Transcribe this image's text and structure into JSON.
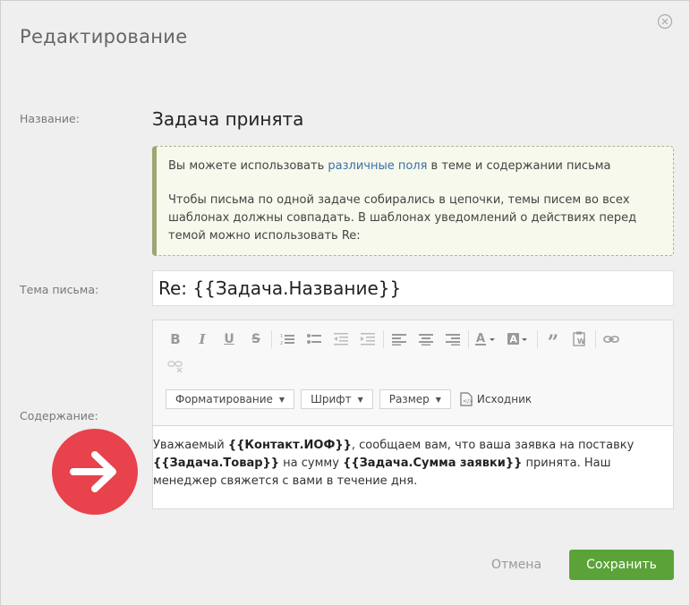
{
  "dialog": {
    "title": "Редактирование"
  },
  "fields": {
    "name_label": "Название:",
    "name_value": "Задача принята",
    "subject_label": "Тема письма:",
    "subject_value": "Re: {{Задача.Название}}",
    "content_label": "Содержание:"
  },
  "info": {
    "line1_before": "Вы можете использовать ",
    "line1_link": "различные поля",
    "line1_after": " в теме и содержании письма",
    "line2": "Чтобы письма по одной задаче собирались в цепочки, темы писем во всех шаблонах должны совпадать. В шаблонах уведомлений о действиях перед темой можно использовать Re:"
  },
  "editor": {
    "format_label": "Форматирование",
    "font_label": "Шрифт",
    "size_label": "Размер",
    "source_label": "Исходник",
    "content": {
      "t1": "Уважаемый ",
      "b1": "{{Контакт.ИОФ}}",
      "t2": ", сообщаем вам, что  ваша заявка на поставку ",
      "b2": "{{Задача.Товар}}",
      "t3": " на сумму ",
      "b3": "{{Задача.Сумма заявки}}",
      "t4": " принята. Наш менеджер свяжется с вами в течение дня."
    }
  },
  "buttons": {
    "cancel": "Отмена",
    "save": "Сохранить"
  },
  "colors": {
    "accent_green": "#5ba339",
    "arrow_red": "#e8424d",
    "link_blue": "#3b6fa8"
  },
  "icons": [
    "close-icon",
    "bold-icon",
    "italic-icon",
    "underline-icon",
    "strikethrough-icon",
    "numbered-list-icon",
    "bullet-list-icon",
    "outdent-icon",
    "indent-icon",
    "align-left-icon",
    "align-center-icon",
    "align-right-icon",
    "text-color-icon",
    "background-color-icon",
    "blockquote-icon",
    "paste-from-word-icon",
    "link-icon",
    "unlink-icon",
    "source-icon",
    "arrow-right-icon"
  ]
}
